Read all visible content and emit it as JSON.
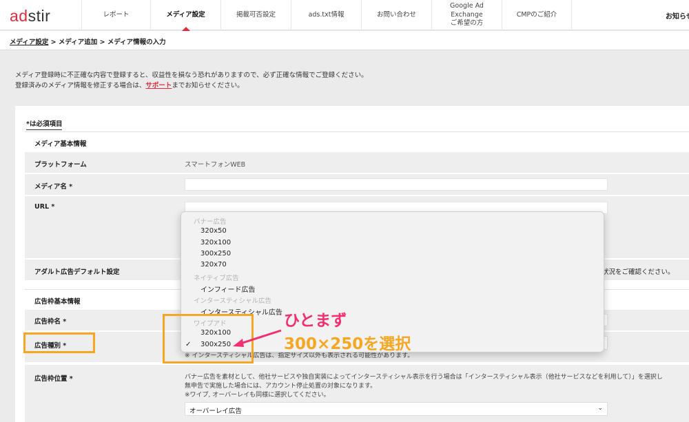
{
  "header": {
    "logo": {
      "part1": "ad",
      "part2": "stir"
    },
    "nav": [
      {
        "label": "レポート"
      },
      {
        "label": "メディア設定"
      },
      {
        "label": "掲載可否設定"
      },
      {
        "label": "ads.txt情報"
      },
      {
        "label": "お問い合わせ"
      },
      {
        "label": "Google Ad\nExchange\nご希望の方"
      },
      {
        "label": "CMPのご紹介"
      }
    ],
    "notice": "お知らせ"
  },
  "breadcrumb": {
    "item1": "メディア設定",
    "sep1": " > ",
    "item2": "メディア追加",
    "sep2": " > ",
    "item3": "メディア情報の入力"
  },
  "intro": {
    "line1": "メディア登録時に不正確な内容で登録すると、収益性を損なう恐れがありますので、必ず正確な情報でご登録ください。",
    "line2_pre": "登録済みのメディア情報を修正する場合は、",
    "line2_link": "サポート",
    "line2_post": "までお知らせください。"
  },
  "form": {
    "required_note": "*は必須項目",
    "section_basic": "メディア基本情報",
    "platform_label": "プラットフォーム",
    "platform_value": "スマートフォンWEB",
    "media_name_label": "メディア名 *",
    "url_label": "URL *",
    "adult_label": "アダルト広告デフォルト設定",
    "adult_note": "状況をご確認ください。",
    "section_adframe": "広告枠基本情報",
    "adframe_name_label": "広告枠名 *",
    "ad_type_label": "広告種別 *",
    "ad_type_note": "※ インタースティシャル広告は、指定サイズ以外も表示される可能性があります。",
    "position_label": "広告枠位置 *",
    "position_note1": "バナー広告を素材として、他社サービスや独自実装によってインタースティシャル表示を行う場合は「インタースティシャル表示（他社サービスなどを利用して）」を選択し",
    "position_note2": "無申告で実施した場合には、アカウント停止処置の対象になります。",
    "position_note3": "※ワイプ, オーバーレイも同様に選択してください。",
    "position_value": "オーバーレイ広告"
  },
  "dropdown": {
    "groups": [
      {
        "label": "バナー広告",
        "options": [
          "320x50",
          "320x100",
          "300x250",
          "320x70"
        ]
      },
      {
        "label": "ネイティブ広告",
        "options": [
          "インフィード広告"
        ]
      },
      {
        "label": "インタースティシャル広告",
        "options": [
          "インタースティシャル広告"
        ]
      },
      {
        "label": "ワイプアド",
        "options": [
          "320x100",
          "300x250"
        ]
      }
    ],
    "selected": "300x250",
    "check_mark": "✓"
  },
  "annotations": {
    "line1": "ひとまず",
    "line2": "300×250を選択"
  },
  "colors": {
    "brand_red": "#e02b3c",
    "annotation_pink": "#f2306e",
    "annotation_orange": "#f5a623"
  }
}
